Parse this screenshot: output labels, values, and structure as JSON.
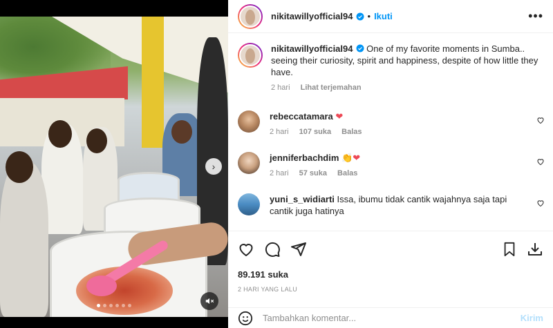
{
  "post": {
    "author": "nikitawillyofficial94",
    "follow_label": "Ikuti",
    "follow_separator": "•",
    "more_label": "•••"
  },
  "caption": {
    "author": "nikitawillyofficial94",
    "text": "One of my favorite moments in Sumba.. seeing their curiosity, spirit and happiness, despite of how little they have.",
    "time": "2 hari",
    "translate_label": "Lihat terjemahan"
  },
  "comments": [
    {
      "username": "rebeccatamara",
      "text": "",
      "emoji": "❤",
      "time": "2 hari",
      "likes": "107 suka",
      "reply": "Balas"
    },
    {
      "username": "jenniferbachdim",
      "text": "",
      "emoji": "👏❤",
      "time": "2 hari",
      "likes": "57 suka",
      "reply": "Balas"
    },
    {
      "username": "yuni_s_widiarti",
      "text": "Issa, ibumu tidak cantik wajahnya saja tapi cantik juga hatinya"
    }
  ],
  "stats": {
    "likes": "89.191 suka",
    "date": "2 HARI YANG LALU"
  },
  "composer": {
    "placeholder": "Tambahkan komentar...",
    "post_label": "Kirim"
  },
  "media": {
    "carousel_dots": 6,
    "active_dot": 0,
    "next_icon": "chevron-right",
    "mute_icon": "speaker-muted"
  },
  "colors": {
    "accent": "#0095f6",
    "post_button_disabled": "#b2dffc",
    "heart_red": "#ed4956",
    "muted_text": "#8e8e8e"
  }
}
